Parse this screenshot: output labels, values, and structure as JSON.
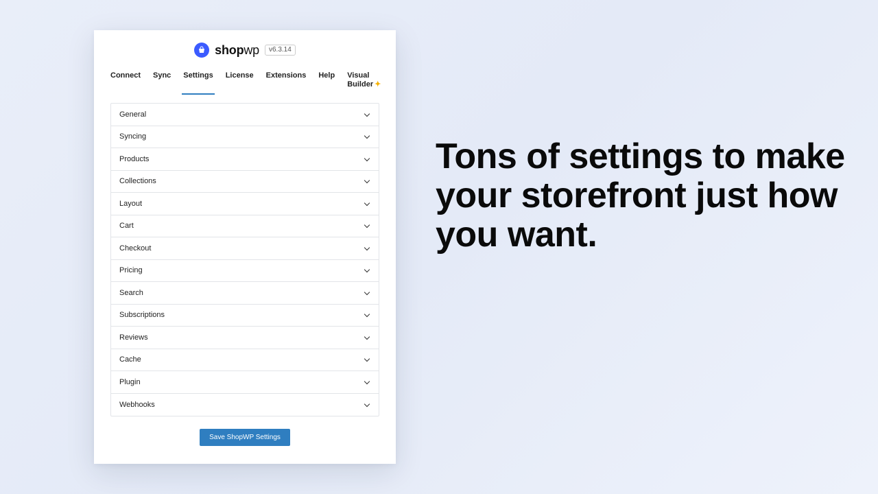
{
  "brand": {
    "name_bold": "shop",
    "name_light": "wp",
    "version": "v6.3.14"
  },
  "tabs": [
    {
      "label": "Connect",
      "active": false
    },
    {
      "label": "Sync",
      "active": false
    },
    {
      "label": "Settings",
      "active": true
    },
    {
      "label": "License",
      "active": false
    },
    {
      "label": "Extensions",
      "active": false
    },
    {
      "label": "Help",
      "active": false
    },
    {
      "label": "Visual Builder",
      "active": false,
      "sparkle": true
    }
  ],
  "sections": [
    "General",
    "Syncing",
    "Products",
    "Collections",
    "Layout",
    "Cart",
    "Checkout",
    "Pricing",
    "Search",
    "Subscriptions",
    "Reviews",
    "Cache",
    "Plugin",
    "Webhooks"
  ],
  "save_button": "Save ShopWP Settings",
  "marketing_headline": "Tons of settings to make your storefront just how you want."
}
